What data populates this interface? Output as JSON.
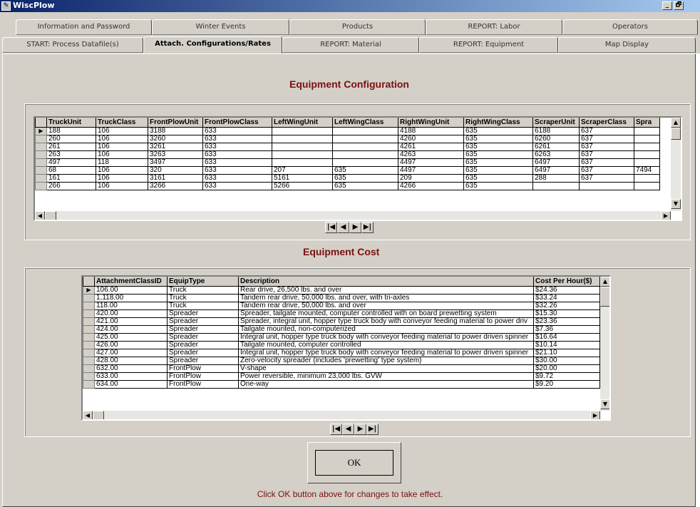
{
  "window": {
    "title": "WiscPlow",
    "controls": [
      "_",
      "🗗",
      "x"
    ]
  },
  "tabs_row1": [
    "Information and Password",
    "Winter Events",
    "Products",
    "REPORT: Labor",
    "Operators"
  ],
  "tabs_row2": [
    "START: Process Datafile(s)",
    "Attach. Configurations/Rates",
    "REPORT: Material",
    "REPORT: Equipment",
    "Map Display"
  ],
  "active_tab": "Attach. Configurations/Rates",
  "equipment_config": {
    "title": "Equipment Configuration",
    "columns": [
      "TruckUnit",
      "TruckClass",
      "FrontPlowUnit",
      "FrontPlowClass",
      "LeftWingUnit",
      "LeftWingClass",
      "RightWingUnit",
      "RightWingClass",
      "ScraperUnit",
      "ScraperClass",
      "Spra"
    ],
    "rows": [
      [
        "188",
        "106",
        "3188",
        "633",
        "",
        "",
        "4188",
        "635",
        "6188",
        "637",
        ""
      ],
      [
        "260",
        "106",
        "3260",
        "633",
        "",
        "",
        "4260",
        "635",
        "6260",
        "637",
        ""
      ],
      [
        "261",
        "106",
        "3261",
        "633",
        "",
        "",
        "4261",
        "635",
        "6261",
        "637",
        ""
      ],
      [
        "263",
        "106",
        "3263",
        "633",
        "",
        "",
        "4263",
        "635",
        "6263",
        "637",
        ""
      ],
      [
        "497",
        "118",
        "3497",
        "633",
        "",
        "",
        "4497",
        "635",
        "6497",
        "637",
        ""
      ],
      [
        "68",
        "106",
        "320",
        "633",
        "207",
        "635",
        "4497",
        "635",
        "6497",
        "637",
        "7494"
      ],
      [
        "161",
        "106",
        "3161",
        "633",
        "5161",
        "635",
        "209",
        "635",
        "288",
        "637",
        ""
      ],
      [
        "266",
        "106",
        "3266",
        "633",
        "5266",
        "635",
        "4266",
        "635",
        "",
        "",
        ""
      ]
    ]
  },
  "equipment_cost": {
    "title": "Equipment Cost",
    "columns": [
      "AttachmentClassID",
      "EquipType",
      "Description",
      "Cost Per Hour($)"
    ],
    "rows": [
      [
        "106.00",
        "Truck",
        "Rear drive, 26,500 lbs. and over",
        "$24.36"
      ],
      [
        "1,118.00",
        "Truck",
        "Tandem rear drive, 50,000 lbs. and over, with tri-axles",
        "$33.24"
      ],
      [
        "118.00",
        "Truck",
        "Tandem rear drive, 50,000 lbs. and over",
        "$32.26"
      ],
      [
        "420.00",
        "Spreader",
        "Spreader, tailgate mounted, computer controlled with on board prewetting system",
        "$15.30"
      ],
      [
        "421.00",
        "Spreader",
        "Spreader, integral unit, hopper type truck body with conveyor feeding material to power driv",
        "$23.36"
      ],
      [
        "424.00",
        "Spreader",
        "Tailgate mounted, non-computerized",
        "$7.36"
      ],
      [
        "425.00",
        "Spreader",
        "Integral unit, hopper type truck body with conveyor feeding material to power driven spinner",
        "$16.64"
      ],
      [
        "426.00",
        "Spreader",
        "Tailgate mounted, computer controlled",
        "$10.14"
      ],
      [
        "427.00",
        "Spreader",
        "Integral unit, hopper type truck body with conveyor feeding material to power driven spinner",
        "$21.10"
      ],
      [
        "428.00",
        "Spreader",
        "Zero-velocity spreader (includes 'prewetting' type system)",
        "$30.00"
      ],
      [
        "632.00",
        "FrontPlow",
        "V-shape",
        "$20.00"
      ],
      [
        "633.00",
        "FrontPlow",
        "Power reversible, minimum 23,000 lbs. GVW",
        "$9.72"
      ],
      [
        "634.00",
        "FrontPlow",
        "One-way",
        "$9.20"
      ]
    ]
  },
  "nav_buttons": [
    "|◀",
    "◀",
    "▶",
    "▶|"
  ],
  "ok_button": "OK",
  "footer_note": "Click OK button above for changes to take effect."
}
